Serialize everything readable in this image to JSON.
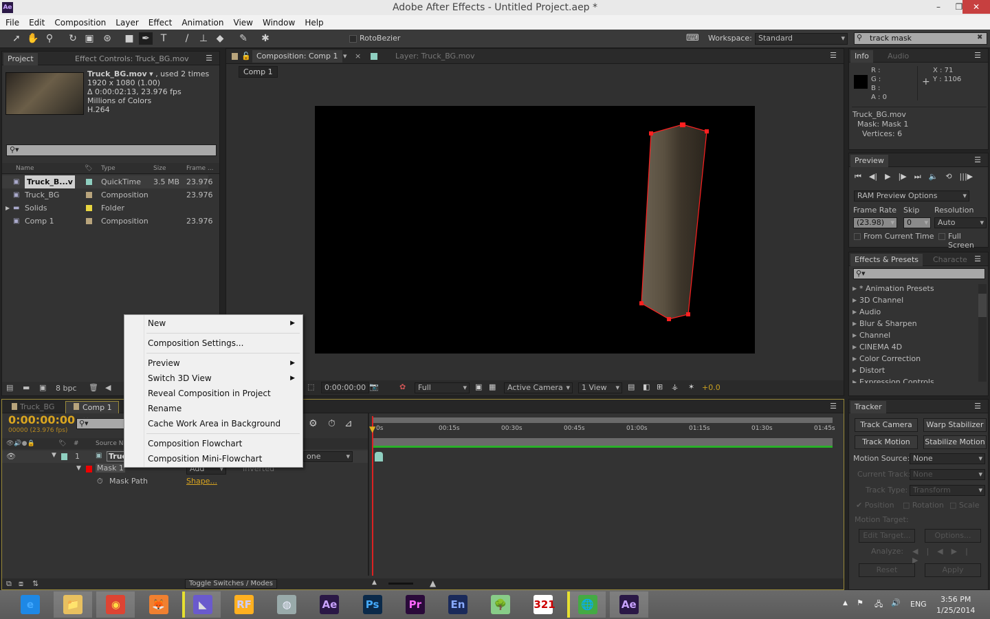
{
  "window": {
    "title": "Adobe After Effects - Untitled Project.aep *",
    "app_icon": "Ae",
    "min": "–",
    "restore": "❐",
    "close": "✕"
  },
  "menu": [
    "File",
    "Edit",
    "Composition",
    "Layer",
    "Effect",
    "Animation",
    "View",
    "Window",
    "Help"
  ],
  "toolbar": {
    "rotobezier": "RotoBezier",
    "workspace_label": "Workspace:",
    "workspace": "Standard",
    "search_value": "track mask"
  },
  "project": {
    "tab": "Project",
    "tab2": "Effect Controls: Truck_BG.mov",
    "info": {
      "name": "Truck_BG.mov",
      "used": ", used 2 times",
      "dims": "1920 x 1080 (1.00)",
      "duration": "Δ 0:00:02:13, 23.976 fps",
      "colors": "Millions of Colors",
      "codec": "H.264"
    },
    "columns": [
      "Name",
      "Type",
      "Size",
      "Frame ..."
    ],
    "items": [
      {
        "name": "Truck_B...v",
        "type": "QuickTime",
        "size": "3.5 MB",
        "frame": "23.976",
        "label": "#8fcfc0",
        "selected": true
      },
      {
        "name": "Truck_BG",
        "type": "Composition",
        "size": "",
        "frame": "23.976",
        "label": "#b8a47c"
      },
      {
        "name": "Solids",
        "type": "Folder",
        "size": "",
        "frame": "",
        "label": "#e8d640"
      },
      {
        "name": "Comp 1",
        "type": "Composition",
        "size": "",
        "frame": "23.976",
        "label": "#b8a47c"
      }
    ],
    "bpc": "8 bpc"
  },
  "comp": {
    "tab": "Composition: Comp 1",
    "tab2": "Layer: Truck_BG.mov",
    "crumb": "Comp 1",
    "time": "0:00:00:00",
    "resolution": "Full",
    "camera": "Active Camera",
    "views": "1 View",
    "exposure": "+0.0"
  },
  "context_menu": [
    {
      "label": "New",
      "submenu": true
    },
    {
      "label": "Composition Settings..."
    },
    {
      "label": "Preview",
      "submenu": true
    },
    {
      "label": "Switch 3D View",
      "submenu": true
    },
    {
      "label": "Reveal Composition in Project"
    },
    {
      "label": "Rename"
    },
    {
      "label": "Cache Work Area in Background"
    },
    {
      "label": "Composition Flowchart"
    },
    {
      "label": "Composition Mini-Flowchart"
    }
  ],
  "info": {
    "tab": "Info",
    "tab2": "Audio",
    "r": "R :",
    "g": "G :",
    "b": "B :",
    "a": "A : 0",
    "x": "X : 71",
    "y": "Y : 1106",
    "l1": "Truck_BG.mov",
    "l2": "Mask: Mask 1",
    "l3": "Vertices: 6"
  },
  "preview": {
    "tab": "Preview",
    "ram": "RAM Preview Options",
    "frame_rate_label": "Frame Rate",
    "skip_label": "Skip",
    "resolution_label": "Resolution",
    "frame_rate": "(23.98)",
    "skip": "0",
    "resolution": "Auto",
    "from_current": "From Current Time",
    "full_screen": "Full Screen"
  },
  "effects": {
    "tab": "Effects & Presets",
    "tab2": "Characte",
    "items": [
      "* Animation Presets",
      "3D Channel",
      "Audio",
      "Blur & Sharpen",
      "Channel",
      "CINEMA 4D",
      "Color Correction",
      "Distort",
      "Expression Controls"
    ]
  },
  "tracker": {
    "tab": "Tracker",
    "track_camera": "Track Camera",
    "warp": "Warp Stabilizer",
    "track_motion": "Track Motion",
    "stabilize": "Stabilize Motion",
    "motion_source_label": "Motion Source:",
    "motion_source": "None",
    "current_track_label": "Current Track:",
    "current_track": "None",
    "track_type_label": "Track Type:",
    "track_type": "Transform",
    "position": "Position",
    "rotation": "Rotation",
    "scale": "Scale",
    "motion_target": "Motion Target:",
    "edit_target": "Edit Target...",
    "options": "Options...",
    "analyze": "Analyze:",
    "reset": "Reset",
    "apply": "Apply"
  },
  "timeline": {
    "tab1": "Truck_BG",
    "tab2": "Comp 1",
    "timecode": "0:00:00:00",
    "frames": "00000 (23.976 fps)",
    "source_col": "Source Na",
    "layer_num": "1",
    "layer_name": "Truc",
    "mode": "one",
    "mask": "Mask 1",
    "mask_mode": "Add",
    "inverted": "Inverted",
    "mask_path": "Mask Path",
    "shape": "Shape...",
    "toggle": "Toggle Switches / Modes",
    "ruler": [
      "0s",
      "00:15s",
      "00:30s",
      "00:45s",
      "01:00s",
      "01:15s",
      "01:30s",
      "01:45s"
    ]
  },
  "taskbar": {
    "apps": [
      "e",
      "📁",
      "◉",
      "🦊",
      "◣",
      "RF",
      "◍",
      "Ae",
      "Ps",
      "Pr",
      "En",
      "🌳",
      "321",
      "🌐",
      "Ae"
    ],
    "lang": "ENG",
    "time": "3:56 PM",
    "date": "1/25/2014"
  }
}
